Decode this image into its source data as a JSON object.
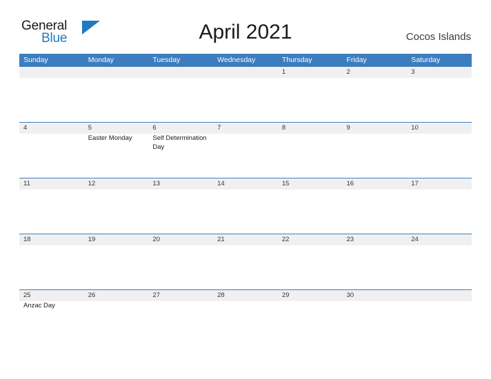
{
  "brand": {
    "name_part1": "General",
    "name_part2": "Blue",
    "flag_color": "#1f7ac0"
  },
  "header": {
    "title": "April 2021",
    "region": "Cocos Islands"
  },
  "colors": {
    "header_blue": "#3c7dbf",
    "band_gray": "#f0f0f0",
    "text_dark": "#1a1a1a"
  },
  "weekdays": [
    "Sunday",
    "Monday",
    "Tuesday",
    "Wednesday",
    "Thursday",
    "Friday",
    "Saturday"
  ],
  "weeks": [
    {
      "days": [
        {
          "num": "",
          "event": ""
        },
        {
          "num": "",
          "event": ""
        },
        {
          "num": "",
          "event": ""
        },
        {
          "num": "",
          "event": ""
        },
        {
          "num": "1",
          "event": ""
        },
        {
          "num": "2",
          "event": ""
        },
        {
          "num": "3",
          "event": ""
        }
      ]
    },
    {
      "days": [
        {
          "num": "4",
          "event": ""
        },
        {
          "num": "5",
          "event": "Easter Monday"
        },
        {
          "num": "6",
          "event": "Self Determination Day"
        },
        {
          "num": "7",
          "event": ""
        },
        {
          "num": "8",
          "event": ""
        },
        {
          "num": "9",
          "event": ""
        },
        {
          "num": "10",
          "event": ""
        }
      ]
    },
    {
      "days": [
        {
          "num": "11",
          "event": ""
        },
        {
          "num": "12",
          "event": ""
        },
        {
          "num": "13",
          "event": ""
        },
        {
          "num": "14",
          "event": ""
        },
        {
          "num": "15",
          "event": ""
        },
        {
          "num": "16",
          "event": ""
        },
        {
          "num": "17",
          "event": ""
        }
      ]
    },
    {
      "days": [
        {
          "num": "18",
          "event": ""
        },
        {
          "num": "19",
          "event": ""
        },
        {
          "num": "20",
          "event": ""
        },
        {
          "num": "21",
          "event": ""
        },
        {
          "num": "22",
          "event": ""
        },
        {
          "num": "23",
          "event": ""
        },
        {
          "num": "24",
          "event": ""
        }
      ]
    },
    {
      "days": [
        {
          "num": "25",
          "event": "Anzac Day"
        },
        {
          "num": "26",
          "event": ""
        },
        {
          "num": "27",
          "event": ""
        },
        {
          "num": "28",
          "event": ""
        },
        {
          "num": "29",
          "event": ""
        },
        {
          "num": "30",
          "event": ""
        },
        {
          "num": "",
          "event": ""
        }
      ]
    }
  ]
}
